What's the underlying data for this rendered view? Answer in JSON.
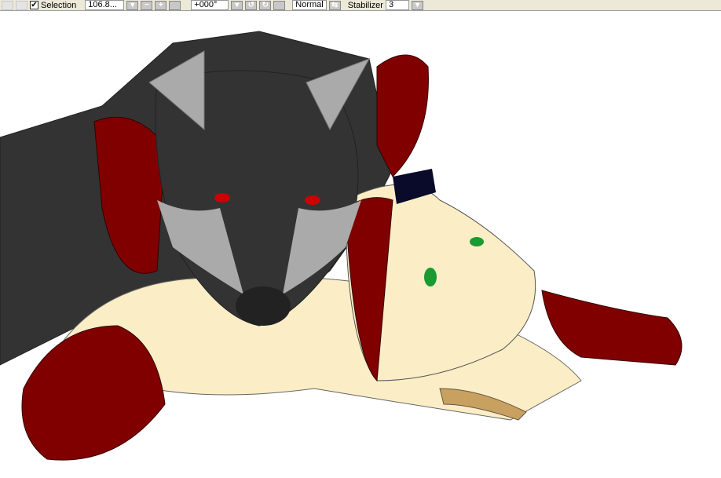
{
  "toolbar": {
    "selection_label": "Selection",
    "selection_checked": true,
    "zoom_value": "106.8...",
    "rotation_value": "+000°",
    "blend_mode": "Normal",
    "stabilizer_label": "Stabilizer",
    "stabilizer_value": "3"
  },
  "icons": {
    "zoom_out": "−",
    "zoom_in": "+",
    "check": "✔",
    "dropdown": "▾",
    "rotate_ccw": "↺",
    "rotate_cw": "↻",
    "flip": "⇆"
  }
}
